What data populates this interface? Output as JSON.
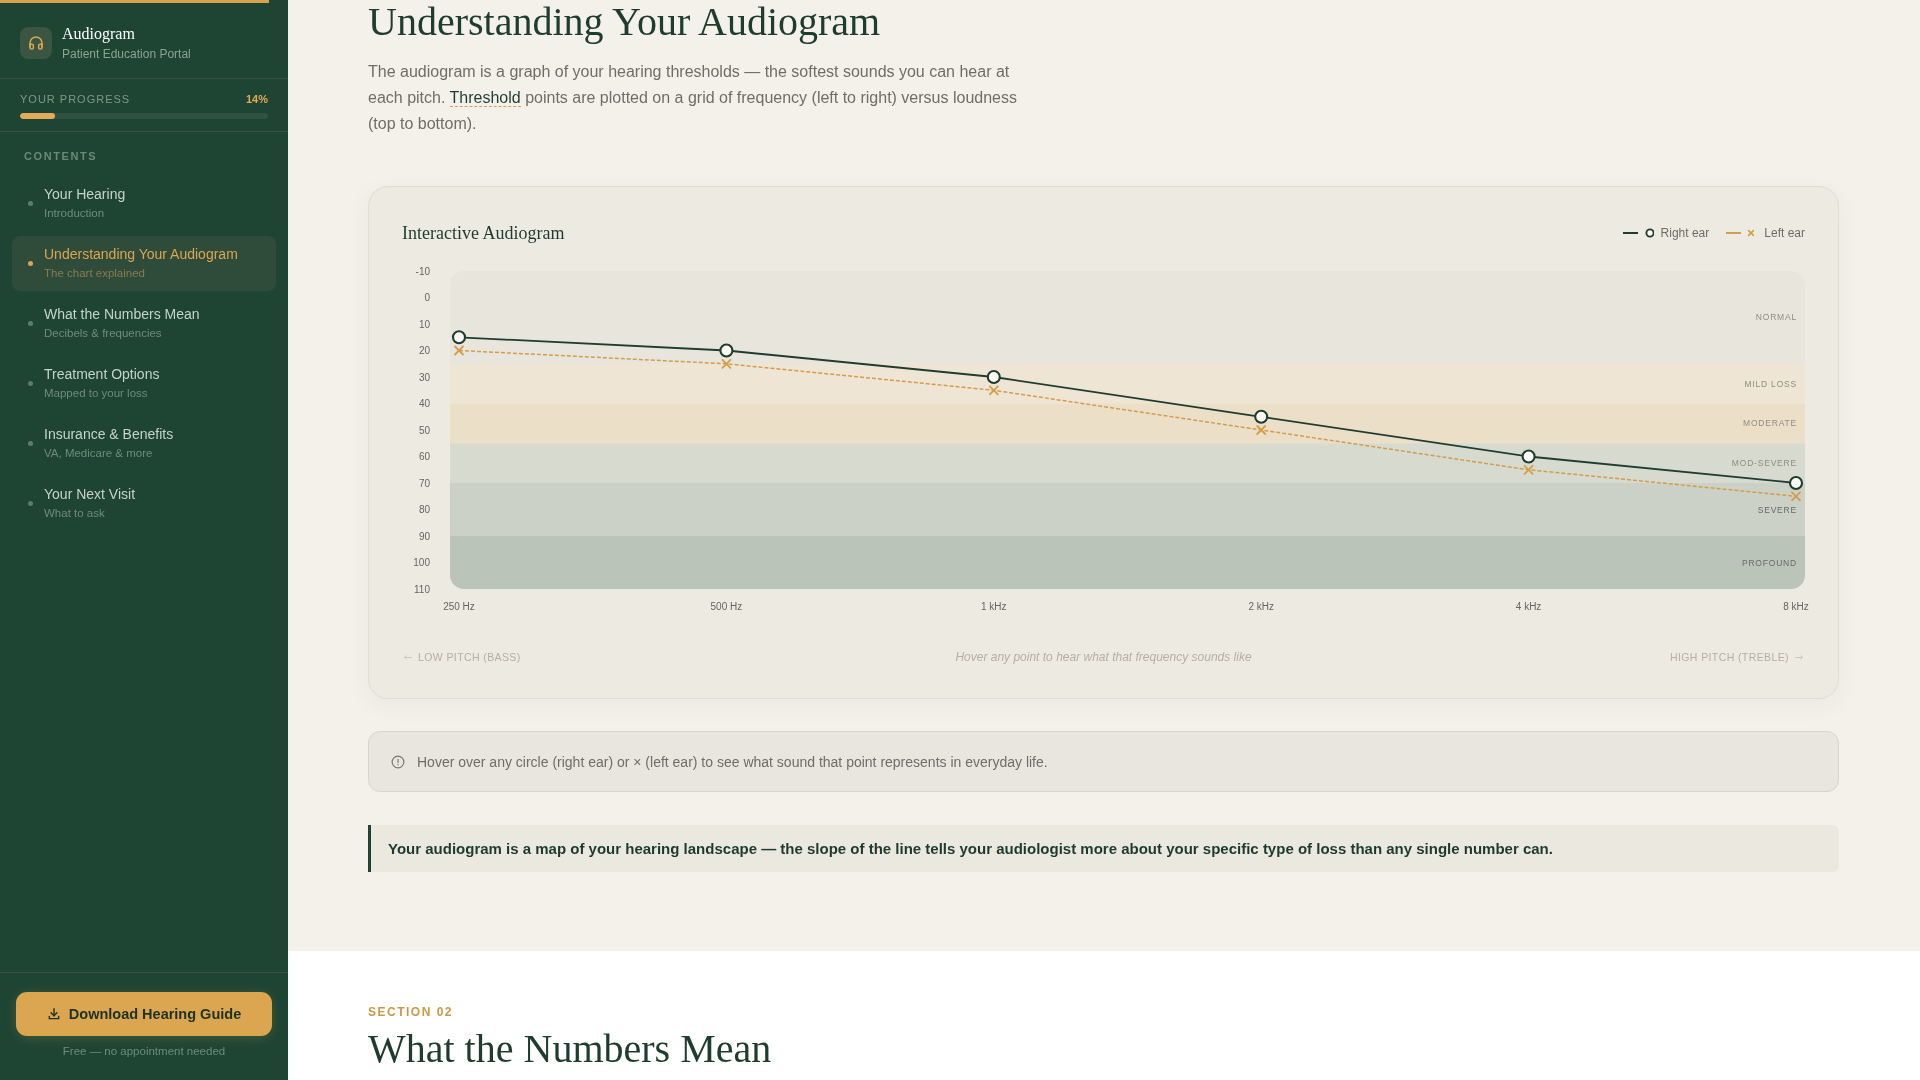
{
  "top_progress": {
    "level": 0.14
  },
  "sidebar": {
    "brand": {
      "title": "Audiogram",
      "subtitle": "Patient Education Portal"
    },
    "progress": {
      "label": "YOUR PROGRESS",
      "value": "14%",
      "level": 0.14
    },
    "contents_heading": "CONTENTS",
    "items": [
      {
        "title": "Your Hearing",
        "subtitle": "Introduction",
        "selected": false
      },
      {
        "title": "Understanding Your Audiogram",
        "subtitle": "The chart explained",
        "selected": true
      },
      {
        "title": "What the Numbers Mean",
        "subtitle": "Decibels & frequencies",
        "selected": false
      },
      {
        "title": "Treatment Options",
        "subtitle": "Mapped to your loss",
        "selected": false
      },
      {
        "title": "Insurance & Benefits",
        "subtitle": "VA, Medicare & more",
        "selected": false
      },
      {
        "title": "Your Next Visit",
        "subtitle": "What to ask",
        "selected": false
      }
    ],
    "download_button": {
      "label": "Download Hearing Guide"
    },
    "download_note": "Free — no appointment needed"
  },
  "main": {
    "title": "Understanding Your Audiogram",
    "intro": {
      "before": "The audiogram is a graph of your hearing thresholds — the softest sounds you can hear at each pitch. ",
      "term": "Threshold",
      "after": " points are plotted on a grid of frequency (left to right) versus loudness (top to bottom)."
    },
    "chart_card": {
      "chart_data": {
        "type": "line",
        "title": "Interactive Audiogram",
        "categories": [
          "250 Hz",
          "500 Hz",
          "1 kHz",
          "2 kHz",
          "4 kHz",
          "8 kHz"
        ],
        "series": [
          {
            "name": "Right ear",
            "color": "#1f3d2f",
            "values": [
              15,
              20,
              30,
              45,
              60,
              70
            ],
            "marker": "circle",
            "line_style": "solid"
          },
          {
            "name": "Left ear",
            "color": "#d49d4a",
            "values": [
              20,
              25,
              35,
              50,
              65,
              75
            ],
            "marker": "cross",
            "line_style": "dashed"
          }
        ],
        "ylim": [
          110,
          -10
        ],
        "yticks": [
          -10,
          0,
          10,
          20,
          30,
          40,
          50,
          60,
          70,
          80,
          90,
          100,
          110
        ],
        "bands": [
          {
            "axis": "y",
            "from": -10,
            "to": 25,
            "label": "NORMAL",
            "color": "#e8e5dc"
          },
          {
            "axis": "y",
            "from": 25,
            "to": 40,
            "label": "MILD LOSS",
            "color": "#eee5d4"
          },
          {
            "axis": "y",
            "from": 40,
            "to": 55,
            "label": "MODERATE",
            "color": "#ecdfc7"
          },
          {
            "axis": "y",
            "from": 55,
            "to": 70,
            "label": "MOD-SEVERE",
            "color": "#d7dacf"
          },
          {
            "axis": "y",
            "from": 70,
            "to": 90,
            "label": "SEVERE",
            "color": "#cbd1c6"
          },
          {
            "axis": "y",
            "from": 90,
            "to": 110,
            "label": "PROFOUND",
            "color": "#bac4b9"
          }
        ]
      },
      "footer": {
        "left": "LOW PITCH (BASS)",
        "hint": "Hover any point to hear what that frequency sounds like",
        "right": "HIGH PITCH (TREBLE)"
      }
    },
    "info_note": "Hover over any circle (right ear) or × (left ear) to see what sound that point represents in everyday life.",
    "callout": "Your audiogram is a map of your hearing landscape — the slope of the line tells your audiologist more about your specific type of loss than any single number can.",
    "next_section": {
      "label": "SECTION 02",
      "title": "What the Numbers Mean"
    }
  }
}
